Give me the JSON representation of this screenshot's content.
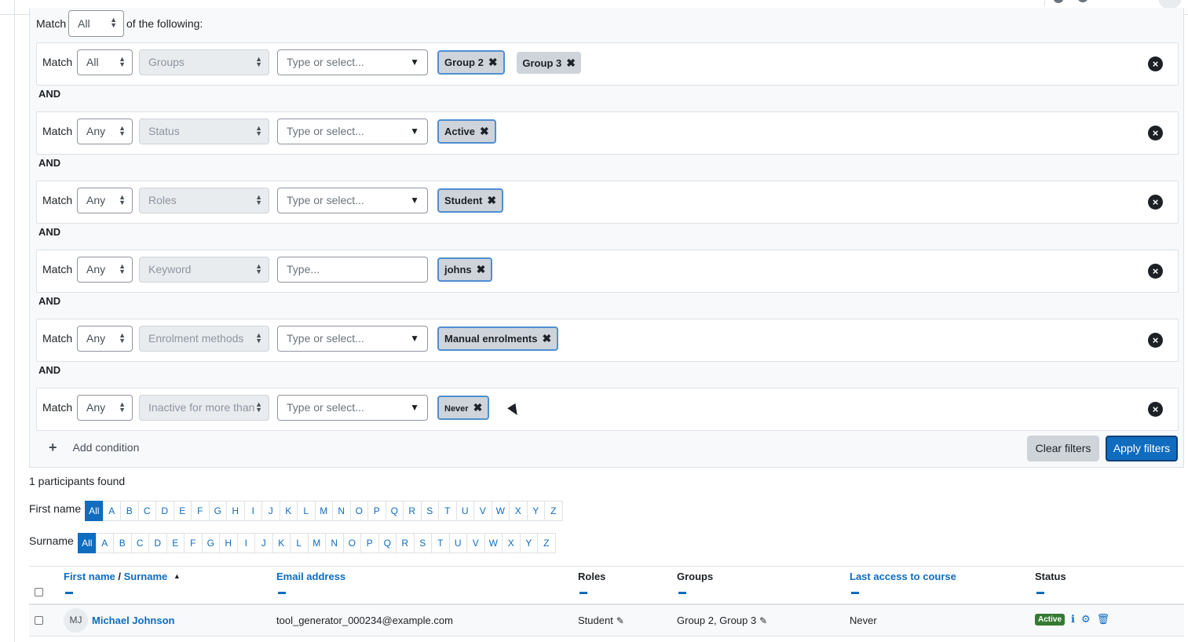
{
  "match_all": {
    "label": "Match",
    "value": "All",
    "suffix": "of the following:"
  },
  "conditions": [
    {
      "match_label": "Match",
      "match": "All",
      "field": "Groups",
      "placeholder": "Type or select...",
      "chips": [
        "Group 2",
        "Group 3"
      ]
    },
    {
      "match_label": "Match",
      "match": "Any",
      "field": "Status",
      "placeholder": "Type or select...",
      "chips": [
        "Active"
      ]
    },
    {
      "match_label": "Match",
      "match": "Any",
      "field": "Roles",
      "placeholder": "Type or select...",
      "chips": [
        "Student"
      ]
    },
    {
      "match_label": "Match",
      "match": "Any",
      "field": "Keyword",
      "placeholder": "Type...",
      "chips": [
        "johns"
      ]
    },
    {
      "match_label": "Match",
      "match": "Any",
      "field": "Enrolment methods",
      "placeholder": "Type or select...",
      "chips": [
        "Manual enrolments"
      ]
    },
    {
      "match_label": "Match",
      "match": "Any",
      "field": "Inactive for more than",
      "placeholder": "Type or select...",
      "chips": [
        "Never"
      ]
    }
  ],
  "joiner": "AND",
  "add_condition": "Add condition",
  "clear_filters": "Clear filters",
  "apply_filters": "Apply filters",
  "found_text": "1 participants found",
  "first_name_label": "First name",
  "surname_label": "Surname",
  "initials": [
    "All",
    "A",
    "B",
    "C",
    "D",
    "E",
    "F",
    "G",
    "H",
    "I",
    "J",
    "K",
    "L",
    "M",
    "N",
    "O",
    "P",
    "Q",
    "R",
    "S",
    "T",
    "U",
    "V",
    "W",
    "X",
    "Y",
    "Z"
  ],
  "table": {
    "headers": {
      "first_name": "First name",
      "slash": "/",
      "surname": "Surname",
      "email": "Email address",
      "roles": "Roles",
      "groups": "Groups",
      "last_access": "Last access to course",
      "status": "Status"
    },
    "rows": [
      {
        "initials": "MJ",
        "name": "Michael Johnson",
        "email": "tool_generator_000234@example.com",
        "roles": "Student",
        "groups": "Group 2, Group 3",
        "last_access": "Never",
        "status": "Active"
      }
    ]
  },
  "icons": {
    "remove": "close-circle-icon",
    "add": "plus-icon",
    "sort": "sort-asc-icon",
    "edit": "pencil-icon",
    "info": "info-icon",
    "settings": "gear-icon",
    "delete": "trash-icon"
  },
  "colors": {
    "accent": "#0f6cbf",
    "active_badge": "#357a32",
    "chip_border": "#4e8fd1"
  }
}
